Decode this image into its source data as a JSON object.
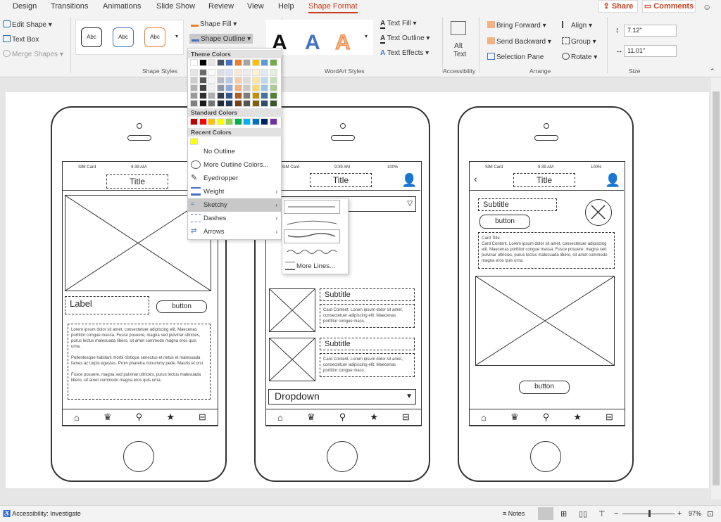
{
  "tabs": [
    "Design",
    "Transitions",
    "Animations",
    "Slide Show",
    "Review",
    "View",
    "Help",
    "Shape Format"
  ],
  "share": "Share",
  "comments": "Comments",
  "ribbon": {
    "edit_shape": "Edit Shape",
    "text_box": "Text Box",
    "merge_shapes": "Merge Shapes",
    "style_sample": "Abc",
    "shape_fill": "Shape Fill",
    "shape_outline": "Shape Outline",
    "group_shape_styles": "Shape Styles",
    "wordart_letter": "A",
    "text_fill": "Text Fill",
    "text_outline": "Text Outline",
    "text_effects": "Text Effects",
    "group_wordart": "WordArt Styles",
    "alt_text": "Alt Text",
    "group_accessibility": "Accessibility",
    "bring_forward": "Bring Forward",
    "send_backward": "Send Backward",
    "selection_pane": "Selection Pane",
    "align": "Align",
    "group": "Group",
    "rotate": "Rotate",
    "group_arrange": "Arrange",
    "height": "7.12\"",
    "width": "11.01\"",
    "group_size": "Size"
  },
  "menu": {
    "theme_colors": "Theme Colors",
    "standard_colors": "Standard Colors",
    "recent_colors": "Recent Colors",
    "no_outline": "No Outline",
    "more_colors": "More Outline Colors...",
    "eyedropper": "Eyedropper",
    "weight": "Weight",
    "sketchy": "Sketchy",
    "dashes": "Dashes",
    "arrows": "Arrows"
  },
  "submenu": {
    "more_lines": "More Lines..."
  },
  "colors": {
    "theme_top": [
      "#ffffff",
      "#000000",
      "#e7e6e6",
      "#44546a",
      "#4472c4",
      "#ed7d31",
      "#a5a5a5",
      "#ffc000",
      "#5b9bd5",
      "#70ad47"
    ],
    "standard": [
      "#c00000",
      "#ff0000",
      "#ffc000",
      "#ffff00",
      "#92d050",
      "#00b050",
      "#00b0f0",
      "#0070c0",
      "#002060",
      "#7030a0"
    ],
    "recent": [
      "#ffff00"
    ]
  },
  "phone1": {
    "sim": "SIM Card",
    "time": "9:39 AM",
    "battery": "100%",
    "title": "Title",
    "label": "Label",
    "button": "button",
    "para": "Lorem ipsum dolor sit amet, consectetuer adipiscing elit. Maecenas porttitor congue massa. Fusce posuere, magna sed pulvinar ultricies, purus lectus malesuada libero, sit amet commodo magna eros quis urna.\n\nPellentesque habitant morbi tristique senectus et netus et malesuada fames ac turpis egestas. Proin pharetra nonummy pede. Mauris et orci.\n\nFusce posuere, magna sed pulvinar ultricies, purus lectus malesuada libero, sit amet commodo magna eros quis urna."
  },
  "phone2": {
    "sim": "SIM Card",
    "time": "9:39 AM",
    "battery": "100%",
    "title": "Title",
    "subtitle": "Subtitle",
    "card": "Card Content. Lorem ipsum dolor sit amet, consectetuer adipiscing elit. Maecenas porttitor congue mass.",
    "dropdown": "Dropdown"
  },
  "phone3": {
    "sim": "SIM Card",
    "time": "9:39 AM",
    "battery": "100%",
    "title": "Title",
    "subtitle": "Subtitle",
    "button": "button",
    "card": "Card Title.\nCard Content. Lorem ipsum dolor sit amet, consectetuer adipiscing elit. Maecenas porttitor congue massa. Fusce posuere, magna sed pulvinar ultricies, purus lectus malesuada libero, sit amet commodo magna eros quis urna.",
    "button2": "button"
  },
  "status": {
    "accessibility": "Accessibility: Investigate",
    "notes": "Notes",
    "zoom": "97%"
  }
}
